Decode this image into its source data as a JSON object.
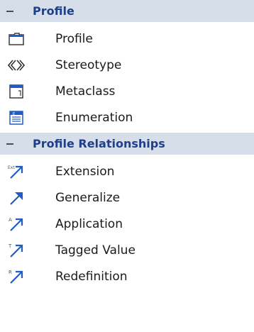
{
  "sections": [
    {
      "title": "Profile",
      "items": [
        {
          "label": "Profile",
          "icon": "package-folder-icon"
        },
        {
          "label": "Stereotype",
          "icon": "stereotype-icon"
        },
        {
          "label": "Metaclass",
          "icon": "metaclass-icon"
        },
        {
          "label": "Enumeration",
          "icon": "enumeration-icon"
        }
      ]
    },
    {
      "title": "Profile Relationships",
      "items": [
        {
          "label": "Extension",
          "icon": "extension-arrow-icon",
          "icon_letters": "Ext"
        },
        {
          "label": "Generalize",
          "icon": "generalize-arrow-icon"
        },
        {
          "label": "Application",
          "icon": "application-arrow-icon",
          "icon_letters": "A"
        },
        {
          "label": "Tagged Value",
          "icon": "tagged-value-arrow-icon",
          "icon_letters": "T"
        },
        {
          "label": "Redefinition",
          "icon": "redefinition-arrow-icon",
          "icon_letters": "R"
        }
      ]
    }
  ],
  "colors": {
    "header_bg": "#d6dee9",
    "header_text": "#1f3f8c",
    "icon_blue": "#1f5cc4"
  }
}
